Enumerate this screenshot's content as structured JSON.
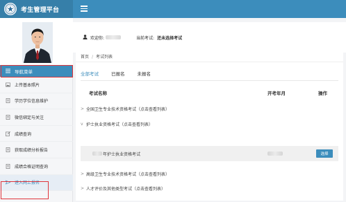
{
  "app": {
    "title": "考生管理平台"
  },
  "sidebar": {
    "nav_header": "导航菜单",
    "items": [
      {
        "label": "上传基本照片",
        "icon": "image-icon"
      },
      {
        "label": "学历学位信息维护",
        "icon": "document-icon"
      },
      {
        "label": "微信绑定与关注",
        "icon": "document-icon"
      },
      {
        "label": "成绩查询",
        "icon": "edit-icon"
      },
      {
        "label": "获取成绩分析报告",
        "icon": "document-icon"
      },
      {
        "label": "成绩合格证明查询",
        "icon": "document-icon"
      },
      {
        "label": "进入网上报名",
        "icon": "send-icon"
      }
    ]
  },
  "header": {
    "welcome_label": "欢迎你:",
    "current_exam_label": "当前考试:",
    "current_exam_value": "还未选择考试"
  },
  "breadcrumb": {
    "home": "首页",
    "separator": "/",
    "current": "考试列表"
  },
  "tabs": [
    {
      "label": "全部考试",
      "active": true
    },
    {
      "label": "已报名",
      "active": false
    },
    {
      "label": "未报名",
      "active": false
    }
  ],
  "table": {
    "col_name": "考试名称",
    "col_date": "开考年月",
    "col_action": "操作",
    "rows": [
      {
        "caret": ">",
        "name": "全国卫生专业技术资格考试（点击查看列表）"
      },
      {
        "caret": "v",
        "name": "护士执业资格考试（点击查看列表）"
      },
      {
        "caret": "",
        "name": "年护士执业资格考试",
        "action": "选择"
      },
      {
        "caret": ">",
        "name": "高级卫生专业技术资格考试（点击查看列表）"
      },
      {
        "caret": ">",
        "name": "人才评价及其他类型考试（点击查看列表）"
      }
    ]
  },
  "colors": {
    "primary": "#3c8dbc",
    "brand_bg": "#367fa9",
    "highlight": "#e0343a"
  }
}
